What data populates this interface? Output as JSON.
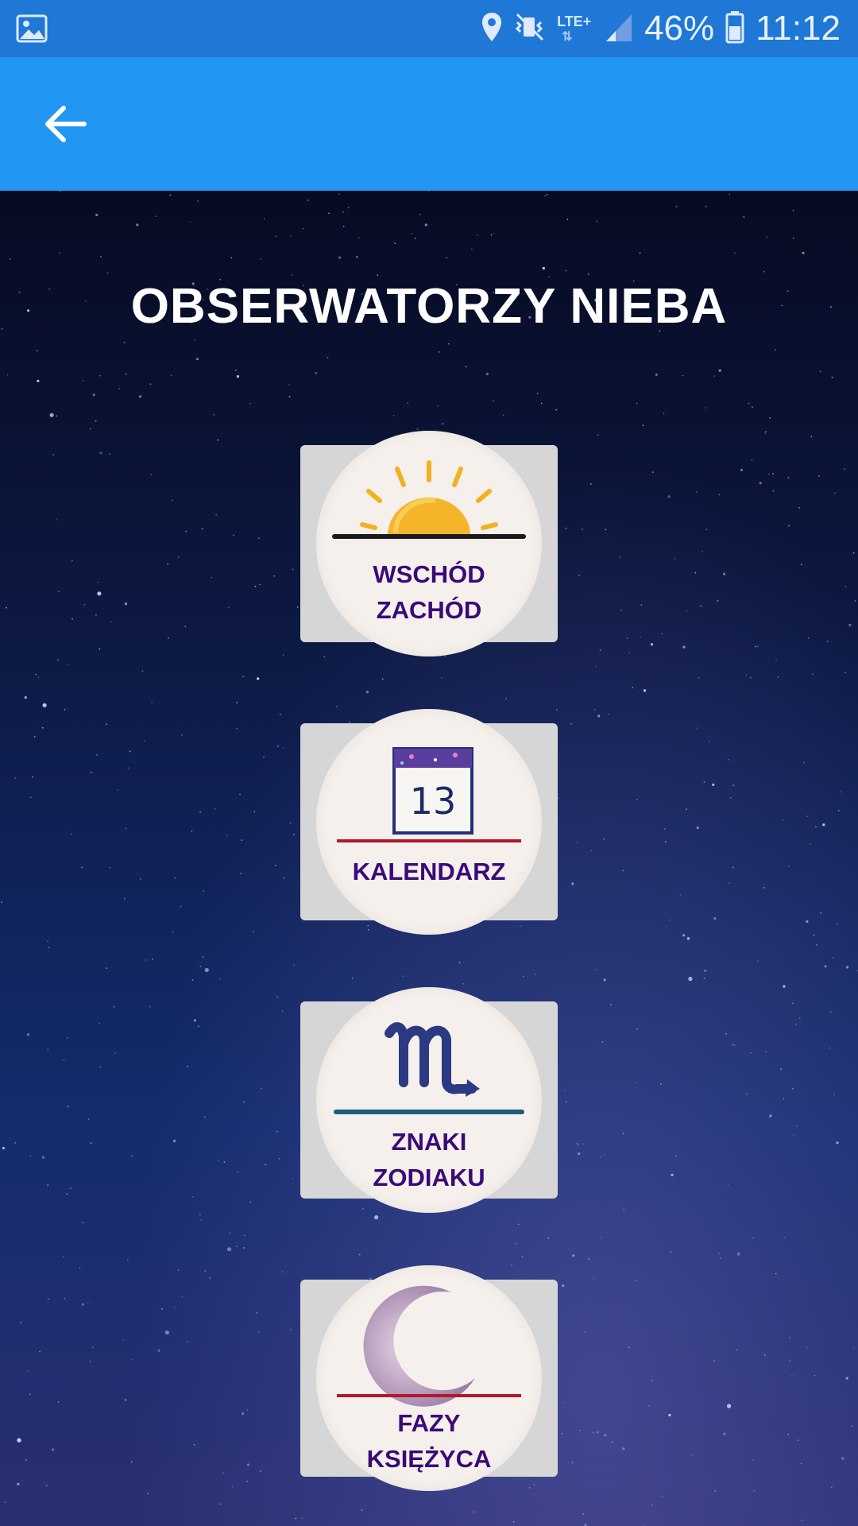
{
  "status_bar": {
    "battery_percent": "46%",
    "time": "11:12",
    "network": "LTE+",
    "icons": [
      "gallery-icon",
      "location-icon",
      "mute-vibrate-icon",
      "lte-icon",
      "signal-icon",
      "battery-icon"
    ]
  },
  "app_bar": {
    "back_icon": "arrow-back-icon",
    "background": "#2196f3"
  },
  "page": {
    "title": "OBSERWATORZY NIEBA"
  },
  "menu": {
    "items": [
      {
        "line1": "WSCHÓD",
        "line2": "ZACHÓD",
        "icon": "sunrise-icon"
      },
      {
        "line1": "KALENDARZ",
        "line2": "",
        "icon": "calendar-icon",
        "calendar_day": "13"
      },
      {
        "line1": "ZNAKI",
        "line2": "ZODIAKU",
        "icon": "scorpio-icon"
      },
      {
        "line1": "FAZY",
        "line2": "KSIĘŻYCA",
        "icon": "crescent-moon-icon"
      }
    ],
    "label_color": "#3a0a78",
    "tile_color": "#d6d6d6"
  }
}
